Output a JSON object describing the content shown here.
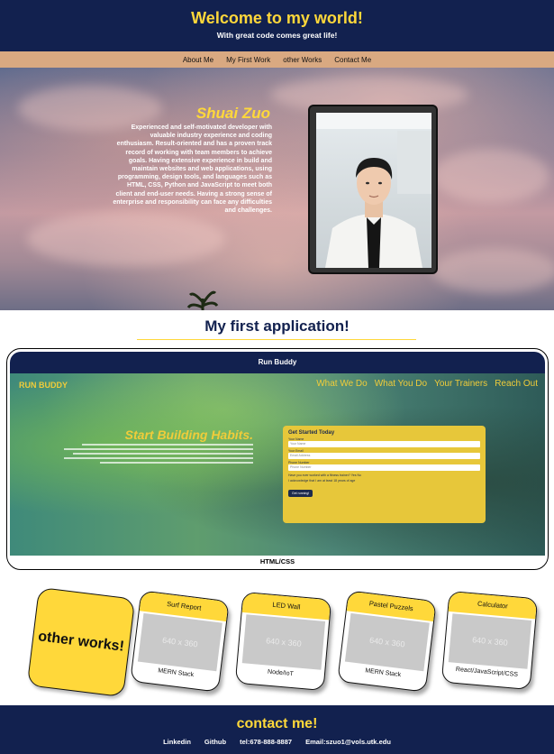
{
  "header": {
    "title": "Welcome to my world!",
    "tagline": "With great code comes great life!"
  },
  "nav": {
    "items": [
      "About Me",
      "My First Work",
      "other Works",
      "Contact Me"
    ]
  },
  "hero": {
    "name": "Shuai Zuo",
    "bio": "Experienced and self-motivated developer with valuable industry experience and coding enthusiasm. Result-oriented and has a proven track record of working with team members to achieve goals. Having extensive experience in build and maintain websites and web applications, using programming, design tools, and languages such as HTML, CSS, Python and JavaScript to meet both client and end-user needs. Having a strong sense of enterprise and responsibility can face any difficulties and challenges."
  },
  "first_app": {
    "section_title": "My first application!",
    "caption": "Run Buddy",
    "tech": "HTML/CSS",
    "preview": {
      "logo": "RUN BUDDY",
      "nav": [
        "What We Do",
        "What You Do",
        "Your Trainers",
        "Reach Out"
      ],
      "headline": "Start Building Habits.",
      "form_title": "Get Started Today",
      "form_name_label": "Your Name",
      "form_name_placeholder": "Your Name",
      "form_email_label": "Your Email",
      "form_email_placeholder": "Email Address",
      "form_phone_label": "Phone Number",
      "form_phone_placeholder": "Phone Number",
      "form_question": "Have you ever worked with a fitness trainer?",
      "form_yes": "Yes",
      "form_no": "No",
      "form_checkbox": "I acknowledge that I am at least 18 years of age",
      "form_button": "Get running!"
    }
  },
  "other_works": {
    "badge": "other works!",
    "placeholder": "640 x 360",
    "cards": [
      {
        "title": "Surf Report",
        "stack": "MERN Stack"
      },
      {
        "title": "LED Wall",
        "stack": "Node/IoT"
      },
      {
        "title": "Pastel Puzzels",
        "stack": "MERN Stack"
      },
      {
        "title": "Calculator",
        "stack": "React/JavaScript/CSS"
      }
    ]
  },
  "footer": {
    "title": "contact me!",
    "links": [
      "Linkedin",
      "Github",
      "tel:678-888-8887",
      "Email:szuo1@vols.utk.edu"
    ]
  },
  "colors": {
    "navy": "#12214f",
    "yellow": "#ffd83a",
    "nav_tan": "#d9a981"
  }
}
